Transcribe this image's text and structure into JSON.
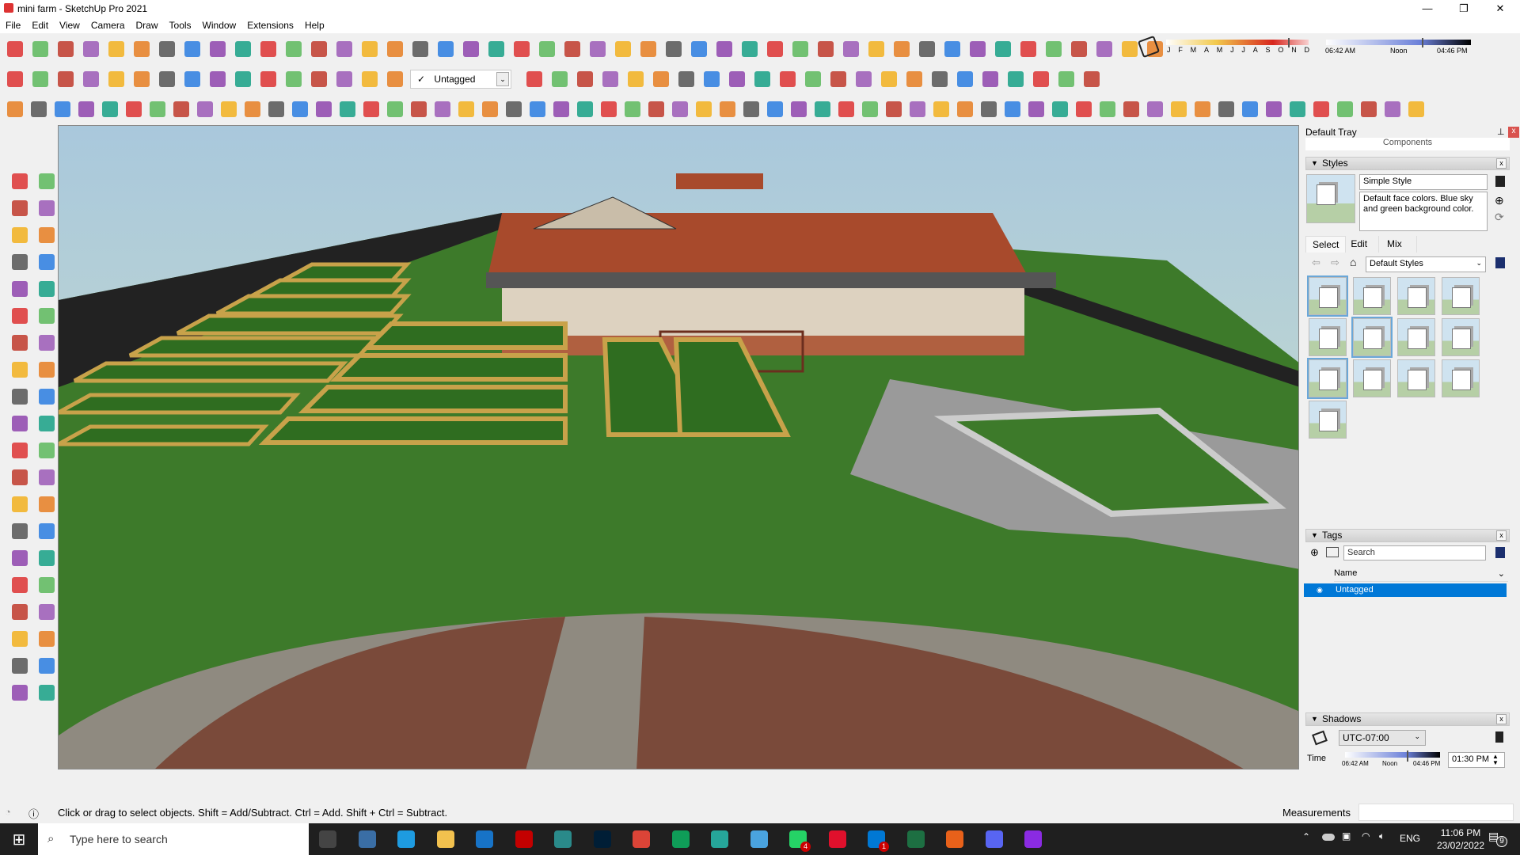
{
  "window": {
    "title": "mini farm - SketchUp Pro 2021",
    "min": "—",
    "max": "❐",
    "close": "✕"
  },
  "menu": [
    "File",
    "Edit",
    "View",
    "Camera",
    "Draw",
    "Tools",
    "Window",
    "Extensions",
    "Help"
  ],
  "tag_dropdown": {
    "check": "✓",
    "value": "Untagged"
  },
  "shadow_bar": {
    "months": [
      "J",
      "F",
      "M",
      "A",
      "M",
      "J",
      "J",
      "A",
      "S",
      "O",
      "N",
      "D"
    ],
    "month_value": "N",
    "start": "06:42 AM",
    "mid": "Noon",
    "end": "04:46 PM"
  },
  "tray": {
    "title": "Default Tray",
    "components": "Components",
    "styles": {
      "title": "Styles",
      "name": "Simple Style",
      "description": "Default face colors. Blue sky and green background color.",
      "tabs": [
        "Select",
        "Edit",
        "Mix"
      ],
      "library": "Default Styles",
      "thumb_count": 13
    },
    "tags": {
      "title": "Tags",
      "search_placeholder": "Search",
      "column": "Name",
      "rows": [
        "Untagged"
      ]
    },
    "shadows": {
      "title": "Shadows",
      "timezone": "UTC-07:00",
      "time_label": "Time",
      "start": "06:42 AM",
      "mid": "Noon",
      "end": "04:46 PM",
      "time_value": "01:30 PM",
      "time_fraction": 0.65
    }
  },
  "status": {
    "message": "Click or drag to select objects. Shift = Add/Subtract. Ctrl = Add. Shift + Ctrl = Subtract.",
    "measurements_label": "Measurements",
    "measurements_value": ""
  },
  "taskbar": {
    "search_placeholder": "Type here to search",
    "lang": "ENG",
    "time": "11:06 PM",
    "date": "23/02/2022",
    "notifications": "9",
    "badge_whatsapp": "4",
    "badge_vscode": "1"
  },
  "colors": {
    "accent": "#0078d7",
    "sky": "#b9d3e2",
    "ground": "#3f7a2a",
    "roof": "#b04a2a"
  }
}
